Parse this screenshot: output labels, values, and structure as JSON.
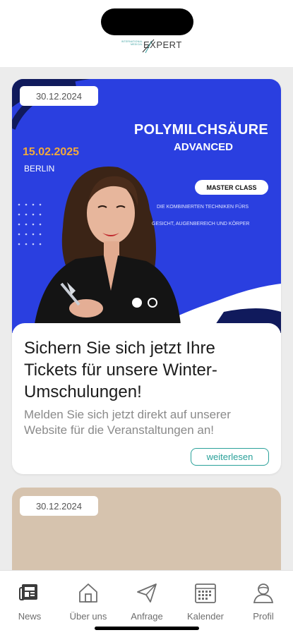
{
  "header": {
    "logo_small": "INTERNATIONAL MEDICAL",
    "logo_big": "EXPERT"
  },
  "feed": [
    {
      "date": "30.12.2024",
      "banner": {
        "title": "POLYMILCHSÄURE",
        "subtitle": "ADVANCED",
        "event_date": "15.02.2025",
        "city": "BERLIN",
        "badge": "MASTER CLASS",
        "desc_line1": "DIE KOMBINIERTEN TECHNIKEN FÜRS",
        "desc_line2": "GESICHT, AUGENBEREICH UND KÖRPER"
      },
      "headline": "Sichern Sie sich jetzt Ihre Tickets für unsere Winter-Umschulungen!",
      "body": "Melden Sie sich jetzt direkt auf unserer Website für die Veranstaltungen an!",
      "more_label": "weiterlesen",
      "carousel": {
        "count": 2,
        "active": 1
      }
    },
    {
      "date": "30.12.2024"
    }
  ],
  "tabs": [
    {
      "label": "News",
      "icon": "newspaper-icon",
      "active": true
    },
    {
      "label": "Über uns",
      "icon": "house-icon"
    },
    {
      "label": "Anfrage",
      "icon": "paper-plane-icon"
    },
    {
      "label": "Kalender",
      "icon": "calendar-icon"
    },
    {
      "label": "Profil",
      "icon": "person-icon"
    }
  ],
  "colors": {
    "banner_blue": "#2a3fe0",
    "accent_teal": "#2aa19a",
    "date_orange": "#f2a93b",
    "card2_beige": "#d6c3ae"
  }
}
